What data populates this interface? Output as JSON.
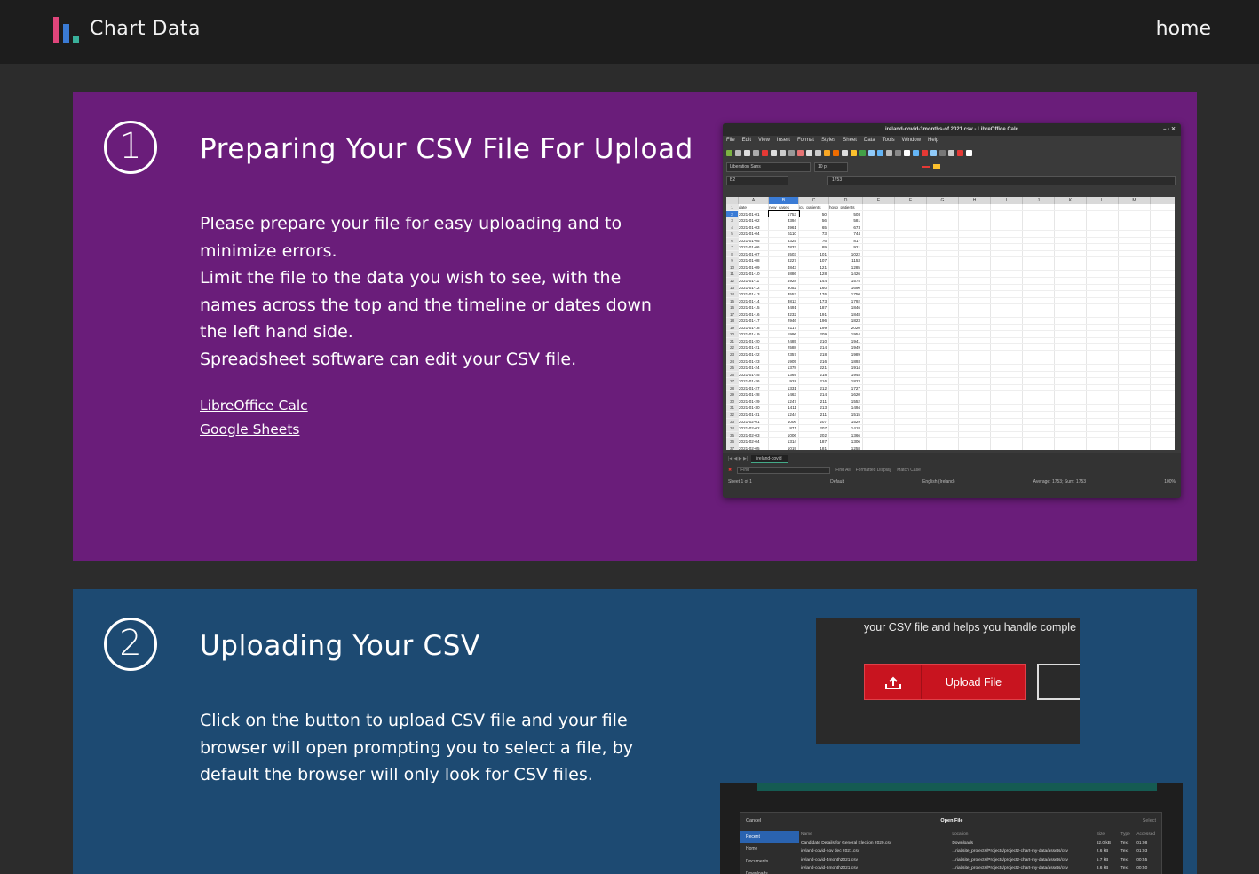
{
  "header": {
    "brand": "Chart Data",
    "home_link": "home",
    "logo_colors": [
      "#e0457b",
      "#3a7bd5",
      "#39b09a"
    ]
  },
  "section1": {
    "step": "1",
    "title": "Preparing Your CSV File For Upload",
    "body": "Please prepare your file for easy uploading and to minimize errors.\nLimit the file to the data you wish to see, with the names across the top and the timeline or dates down the left hand side.\nSpreadsheet software can edit your CSV file.",
    "links": [
      "LibreOffice Calc",
      "Google Sheets"
    ],
    "bg_color": "#6a1d7a"
  },
  "section2": {
    "step": "2",
    "title": "Uploading Your CSV",
    "body": "Click on the button to upload CSV file and your file browser will open prompting you to select a file, by default the browser will only look for CSV files.",
    "bg_color": "#1d4a72"
  },
  "calc_screenshot": {
    "window_title": "ireland-covid-3months-of 2021.csv - LibreOffice Calc",
    "menu": [
      "File",
      "Edit",
      "View",
      "Insert",
      "Format",
      "Styles",
      "Sheet",
      "Data",
      "Tools",
      "Window",
      "Help"
    ],
    "font_name": "Liberation Sans",
    "font_size": "10 pt",
    "name_box": "B2",
    "formula_value": "1753",
    "columns": [
      "A",
      "B",
      "C",
      "D",
      "E",
      "F",
      "G",
      "H",
      "I",
      "J",
      "K",
      "L",
      "M"
    ],
    "headers": [
      "date",
      "new_cases",
      "icu_patients",
      "hosp_patients"
    ],
    "rows": [
      [
        "2021-01-01",
        "1753",
        "50",
        "508"
      ],
      [
        "2021-01-02",
        "3394",
        "56",
        "581"
      ],
      [
        "2021-01-03",
        "4961",
        "65",
        "673"
      ],
      [
        "2021-01-04",
        "6110",
        "73",
        "744"
      ],
      [
        "2021-01-05",
        "5325",
        "76",
        "817"
      ],
      [
        "2021-01-06",
        "7832",
        "89",
        "921"
      ],
      [
        "2021-01-07",
        "6503",
        "101",
        "1022"
      ],
      [
        "2021-01-08",
        "8227",
        "107",
        "1153"
      ],
      [
        "2021-01-09",
        "4843",
        "121",
        "1285"
      ],
      [
        "2021-01-10",
        "6886",
        "128",
        "1426"
      ],
      [
        "2021-01-11",
        "4928",
        "144",
        "1575"
      ],
      [
        "2021-01-12",
        "3052",
        "160",
        "1690"
      ],
      [
        "2021-01-13",
        "3553",
        "176",
        "1750"
      ],
      [
        "2021-01-14",
        "3813",
        "173",
        "1792"
      ],
      [
        "2021-01-15",
        "3491",
        "187",
        "1846"
      ],
      [
        "2021-01-16",
        "3232",
        "191",
        "1848"
      ],
      [
        "2021-01-17",
        "2946",
        "196",
        "1823"
      ],
      [
        "2021-01-18",
        "2117",
        "199",
        "2020"
      ],
      [
        "2021-01-19",
        "1996",
        "209",
        "1954"
      ],
      [
        "2021-01-20",
        "2485",
        "210",
        "1941"
      ],
      [
        "2021-01-21",
        "2588",
        "214",
        "1949"
      ],
      [
        "2021-01-22",
        "2357",
        "218",
        "1989"
      ],
      [
        "2021-01-23",
        "1905",
        "216",
        "1893"
      ],
      [
        "2021-01-24",
        "1378",
        "221",
        "1914"
      ],
      [
        "2021-01-25",
        "1369",
        "218",
        "1948"
      ],
      [
        "2021-01-26",
        "928",
        "216",
        "1823"
      ],
      [
        "2021-01-27",
        "1331",
        "212",
        "1727"
      ],
      [
        "2021-01-28",
        "1463",
        "214",
        "1620"
      ],
      [
        "2021-01-29",
        "1247",
        "211",
        "1552"
      ],
      [
        "2021-01-30",
        "1411",
        "213",
        "1494"
      ],
      [
        "2021-01-31",
        "1244",
        "211",
        "1515"
      ],
      [
        "2021-02-01",
        "1006",
        "207",
        "1529"
      ],
      [
        "2021-02-02",
        "871",
        "207",
        "1418"
      ],
      [
        "2021-02-03",
        "1006",
        "202",
        "1366"
      ],
      [
        "2021-02-04",
        "1314",
        "187",
        "1306"
      ],
      [
        "2021-02-05",
        "1019",
        "181",
        "1258"
      ]
    ],
    "sheet_tab": "ireland-covid",
    "find_placeholder": "Find",
    "find_all": "Find All",
    "formatted_display": "Formatted Display",
    "match_case": "Match Case",
    "status_sheet": "Sheet 1 of 1",
    "status_style": "Default",
    "status_lang": "English (Ireland)",
    "status_sum": "Average: 1753; Sum: 1753",
    "zoom": "100%"
  },
  "upload_screenshot": {
    "text": "your CSV file and helps you handle comple",
    "button_label": "Upload File"
  },
  "dialog_screenshot": {
    "cancel": "Cancel",
    "title": "Open File",
    "select": "Select",
    "sidebar": [
      "Recent",
      "Home",
      "Documents",
      "Downloads"
    ],
    "columns": [
      "Name",
      "Location",
      "Size",
      "Type",
      "Accessed"
    ],
    "files": [
      [
        "Candidate Details for General Election 2020.csv",
        "Downloads",
        "62.0 kB",
        "Text",
        "01:08"
      ],
      [
        "ireland-covid-nov dec 2021.csv",
        "...rial/site_projects/Projects/project2-chart-my-data/assets/csv",
        "2.6 kB",
        "Text",
        "01:03"
      ],
      [
        "ireland-covid-4month2021.csv",
        "...rial/site_projects/Projects/project2-chart-my-data/assets/csv",
        "5.7 kB",
        "Text",
        "00:55"
      ],
      [
        "ireland-covid-6month2021.csv",
        "...rial/site_projects/Projects/project2-chart-my-data/assets/csv",
        "8.6 kB",
        "Text",
        "00:50"
      ]
    ]
  }
}
